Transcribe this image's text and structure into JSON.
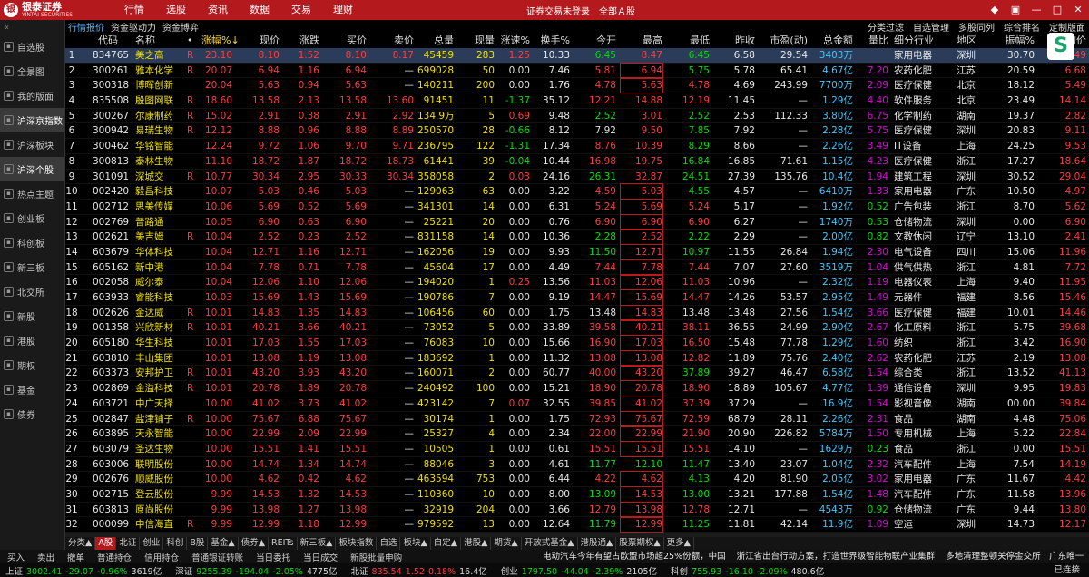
{
  "app": {
    "brand": "银泰证券",
    "brand_en": "YINTAI SECURITIES",
    "logo_mark": "银"
  },
  "top_menu": [
    "行情",
    "选股",
    "资讯",
    "数据",
    "交易",
    "理财"
  ],
  "top_status": {
    "login": "证券交易未登录",
    "scope": "全部Ａ股"
  },
  "window_controls": [
    "◆",
    "▣",
    "—",
    "□",
    "✕"
  ],
  "sidebar": [
    {
      "label": "自选股",
      "active": false
    },
    {
      "label": "全景图",
      "active": false
    },
    {
      "label": "我的版面",
      "active": false
    },
    {
      "label": "沪深京指数",
      "active": true
    },
    {
      "label": "沪深板块",
      "active": false
    },
    {
      "label": "沪深个股",
      "active": true
    },
    {
      "label": "热点主题",
      "active": false
    },
    {
      "label": "创业板",
      "active": false
    },
    {
      "label": "科创板",
      "active": false
    },
    {
      "label": "新三板",
      "active": false
    },
    {
      "label": "北交所",
      "active": false
    },
    {
      "label": "新股",
      "active": false
    },
    {
      "label": "港股",
      "active": false
    },
    {
      "label": "期权",
      "active": false
    },
    {
      "label": "基金",
      "active": false
    },
    {
      "label": "债券",
      "active": false
    }
  ],
  "sub_tabs": [
    "行情报价",
    "资金驱动力",
    "资金博弈"
  ],
  "sub_right": [
    "分类过滤",
    "自选管理",
    "多股同列",
    "综合排名",
    "定制版面"
  ],
  "columns": [
    "",
    "代码",
    "名称",
    "•",
    "涨幅%↓",
    "现价",
    "涨跌",
    "买价",
    "卖价",
    "总量",
    "现量",
    "涨速%",
    "换手%",
    "今开",
    "最高",
    "最低",
    "昨收",
    "市盈(动)",
    "总金额",
    "量比",
    "细分行业",
    "地区",
    "振幅%",
    "均价"
  ],
  "rows": [
    [
      "1",
      "834765",
      "美之高",
      "R",
      "23.10",
      "8.10",
      "1.52",
      "8.10",
      "8.17",
      "45459",
      "283",
      "1.25",
      "10.33",
      "6.45",
      "8.47",
      "6.45",
      "6.58",
      "29.54",
      "3403万",
      "",
      "家用电器",
      "深圳",
      "30.70",
      "7.49"
    ],
    [
      "2",
      "300261",
      "雅本化学",
      "R",
      "20.07",
      "6.94",
      "1.16",
      "6.94",
      "—",
      "699028",
      "50",
      "0.00",
      "7.46",
      "5.81",
      "6.94",
      "5.75",
      "5.78",
      "65.41",
      "4.67亿",
      "7.20",
      "农药化肥",
      "江苏",
      "20.59",
      "6.68"
    ],
    [
      "3",
      "300318",
      "博晖创新",
      "",
      "20.04",
      "5.63",
      "0.94",
      "5.63",
      "—",
      "140211",
      "200",
      "0.00",
      "1.76",
      "4.78",
      "5.63",
      "4.78",
      "4.69",
      "243.99",
      "7700万",
      "2.09",
      "医疗保健",
      "北京",
      "18.12",
      "5.49"
    ],
    [
      "4",
      "835508",
      "殷图网联",
      "R",
      "18.60",
      "13.58",
      "2.13",
      "13.58",
      "13.60",
      "91451",
      "11",
      "-1.37",
      "35.12",
      "12.21",
      "14.88",
      "12.19",
      "11.45",
      "—",
      "1.29亿",
      "4.40",
      "软件服务",
      "北京",
      "23.49",
      "14.14"
    ],
    [
      "5",
      "300267",
      "尔康制药",
      "R",
      "15.02",
      "2.91",
      "0.38",
      "2.91",
      "2.92",
      "134.9万",
      "5",
      "0.69",
      "9.48",
      "2.52",
      "3.01",
      "2.52",
      "2.53",
      "112.33",
      "3.80亿",
      "6.75",
      "化学制药",
      "湖南",
      "19.37",
      "2.82"
    ],
    [
      "6",
      "300942",
      "易瑞生物",
      "R",
      "12.12",
      "8.88",
      "0.96",
      "8.88",
      "8.89",
      "250570",
      "28",
      "-0.66",
      "8.12",
      "7.92",
      "9.50",
      "7.85",
      "7.92",
      "—",
      "2.28亿",
      "5.75",
      "医疗保健",
      "深圳",
      "20.83",
      "9.11"
    ],
    [
      "7",
      "300462",
      "华铭智能",
      "",
      "12.24",
      "9.72",
      "1.06",
      "9.70",
      "9.71",
      "236795",
      "122",
      "-1.31",
      "17.34",
      "8.76",
      "10.39",
      "8.29",
      "8.66",
      "—",
      "2.26亿",
      "3.49",
      "IT设备",
      "上海",
      "24.25",
      "9.53"
    ],
    [
      "8",
      "300813",
      "泰林生物",
      "",
      "11.10",
      "18.72",
      "1.87",
      "18.72",
      "18.73",
      "61441",
      "39",
      "-0.04",
      "10.44",
      "16.98",
      "19.75",
      "16.84",
      "16.85",
      "71.61",
      "1.15亿",
      "4.23",
      "医疗保健",
      "浙江",
      "17.27",
      "18.64"
    ],
    [
      "9",
      "301091",
      "深城交",
      "R",
      "10.77",
      "30.34",
      "2.95",
      "30.33",
      "30.34",
      "358058",
      "2",
      "0.03",
      "24.16",
      "26.31",
      "32.87",
      "24.51",
      "27.39",
      "135.76",
      "10.4亿",
      "1.94",
      "建筑工程",
      "深圳",
      "30.52",
      "29.04"
    ],
    [
      "10",
      "002420",
      "毅昌科技",
      "",
      "10.07",
      "5.03",
      "0.46",
      "5.03",
      "—",
      "129063",
      "63",
      "0.00",
      "3.22",
      "4.59",
      "5.03",
      "4.55",
      "4.57",
      "—",
      "6410万",
      "1.33",
      "家用电器",
      "广东",
      "10.50",
      "4.97"
    ],
    [
      "11",
      "002712",
      "思美传媒",
      "",
      "10.06",
      "5.69",
      "0.52",
      "5.69",
      "—",
      "341301",
      "14",
      "0.00",
      "6.31",
      "5.24",
      "5.69",
      "5.24",
      "5.17",
      "—",
      "1.92亿",
      "0.52",
      "广告包装",
      "浙江",
      "8.70",
      "5.62"
    ],
    [
      "12",
      "002769",
      "普路通",
      "",
      "10.05",
      "6.90",
      "0.63",
      "6.90",
      "—",
      "25221",
      "20",
      "0.00",
      "0.76",
      "6.90",
      "6.90",
      "6.90",
      "6.27",
      "—",
      "1740万",
      "0.53",
      "仓储物流",
      "深圳",
      "0.00",
      "6.90"
    ],
    [
      "13",
      "002621",
      "美吉姆",
      "R",
      "10.04",
      "2.52",
      "0.23",
      "2.52",
      "—",
      "831158",
      "14",
      "0.00",
      "10.36",
      "2.28",
      "2.52",
      "2.22",
      "2.29",
      "—",
      "2.00亿",
      "0.82",
      "文教休闲",
      "辽宁",
      "13.10",
      "2.41"
    ],
    [
      "14",
      "603679",
      "华体科技",
      "",
      "10.04",
      "12.71",
      "1.16",
      "12.71",
      "—",
      "162056",
      "19",
      "0.00",
      "9.93",
      "11.50",
      "12.71",
      "10.97",
      "11.55",
      "26.84",
      "1.94亿",
      "2.30",
      "电气设备",
      "四川",
      "15.06",
      "11.96"
    ],
    [
      "15",
      "605162",
      "新中港",
      "",
      "10.04",
      "7.78",
      "0.71",
      "7.78",
      "—",
      "45604",
      "17",
      "0.00",
      "4.49",
      "7.44",
      "7.78",
      "7.44",
      "7.07",
      "27.60",
      "3519万",
      "1.04",
      "供气供热",
      "浙江",
      "4.81",
      "7.72"
    ],
    [
      "16",
      "002058",
      "威尔泰",
      "",
      "10.04",
      "12.06",
      "1.10",
      "12.06",
      "—",
      "194020",
      "1",
      "0.25",
      "13.56",
      "11.03",
      "12.06",
      "11.03",
      "10.96",
      "—",
      "2.32亿",
      "1.19",
      "电器仪表",
      "上海",
      "9.40",
      "11.95"
    ],
    [
      "17",
      "603933",
      "睿能科技",
      "",
      "10.03",
      "15.69",
      "1.43",
      "15.69",
      "—",
      "190786",
      "7",
      "0.00",
      "9.19",
      "14.47",
      "15.69",
      "14.47",
      "14.26",
      "53.57",
      "2.95亿",
      "1.49",
      "元器件",
      "福建",
      "8.56",
      "15.46"
    ],
    [
      "18",
      "002626",
      "金达威",
      "R",
      "10.01",
      "14.83",
      "1.35",
      "14.83",
      "—",
      "106456",
      "60",
      "0.00",
      "1.75",
      "13.48",
      "14.83",
      "13.48",
      "13.48",
      "27.56",
      "1.54亿",
      "3.66",
      "医疗保健",
      "福建",
      "10.01",
      "14.46"
    ],
    [
      "19",
      "001358",
      "兴欣新材",
      "R",
      "10.01",
      "40.21",
      "3.66",
      "40.21",
      "—",
      "73052",
      "5",
      "0.00",
      "33.89",
      "39.58",
      "40.21",
      "38.11",
      "36.55",
      "24.99",
      "2.90亿",
      "2.67",
      "化工原料",
      "浙江",
      "5.75",
      "39.68"
    ],
    [
      "20",
      "605180",
      "华生科技",
      "",
      "10.01",
      "17.03",
      "1.55",
      "17.03",
      "—",
      "76083",
      "10",
      "0.00",
      "15.66",
      "16.90",
      "17.03",
      "16.50",
      "15.48",
      "77.78",
      "1.29亿",
      "1.60",
      "纺织",
      "浙江",
      "3.42",
      "16.90"
    ],
    [
      "21",
      "603810",
      "丰山集团",
      "",
      "10.01",
      "13.08",
      "1.19",
      "13.08",
      "—",
      "183692",
      "1",
      "0.00",
      "11.32",
      "13.08",
      "13.08",
      "12.82",
      "11.89",
      "75.76",
      "2.40亿",
      "2.62",
      "农药化肥",
      "江苏",
      "2.19",
      "13.08"
    ],
    [
      "22",
      "603373",
      "安邦护卫",
      "R",
      "10.01",
      "43.20",
      "3.93",
      "43.20",
      "—",
      "160071",
      "2",
      "0.00",
      "60.77",
      "40.00",
      "43.20",
      "37.89",
      "39.27",
      "46.47",
      "6.58亿",
      "1.54",
      "综合类",
      "浙江",
      "13.52",
      "41.13"
    ],
    [
      "23",
      "002869",
      "金溢科技",
      "R",
      "10.01",
      "20.78",
      "1.89",
      "20.78",
      "—",
      "240492",
      "100",
      "0.00",
      "15.21",
      "18.90",
      "20.78",
      "18.90",
      "18.89",
      "105.67",
      "4.77亿",
      "1.39",
      "通信设备",
      "深圳",
      "9.95",
      "19.83"
    ],
    [
      "24",
      "603721",
      "中广天择",
      "",
      "10.00",
      "41.02",
      "3.73",
      "41.02",
      "—",
      "423142",
      "7",
      "0.07",
      "32.55",
      "39.85",
      "41.02",
      "37.39",
      "37.29",
      "—",
      "16.9亿",
      "1.54",
      "影视音像",
      "湖南",
      "00.00",
      "39.84"
    ],
    [
      "25",
      "002847",
      "盐津铺子",
      "R",
      "10.00",
      "75.67",
      "6.88",
      "75.67",
      "—",
      "30174",
      "1",
      "0.00",
      "1.75",
      "72.93",
      "75.67",
      "72.59",
      "68.79",
      "28.11",
      "2.26亿",
      "2.31",
      "食品",
      "湖南",
      "4.48",
      "75.06"
    ],
    [
      "26",
      "603895",
      "天永智能",
      "",
      "10.00",
      "22.99",
      "2.09",
      "22.99",
      "—",
      "25327",
      "4",
      "0.00",
      "2.34",
      "22.00",
      "22.99",
      "21.90",
      "20.90",
      "226.82",
      "5784万",
      "1.50",
      "专用机械",
      "上海",
      "5.22",
      "22.84"
    ],
    [
      "27",
      "603079",
      "圣达生物",
      "",
      "10.00",
      "15.51",
      "1.41",
      "15.51",
      "—",
      "10505",
      "1",
      "0.00",
      "0.61",
      "15.51",
      "15.51",
      "15.51",
      "14.10",
      "—",
      "1629万",
      "0.23",
      "食品",
      "浙江",
      "0.00",
      "15.51"
    ],
    [
      "28",
      "603006",
      "联明股份",
      "",
      "10.00",
      "14.74",
      "1.34",
      "14.74",
      "—",
      "88046",
      "3",
      "0.00",
      "4.61",
      "11.77",
      "12.10",
      "11.47",
      "13.40",
      "23.07",
      "1.04亿",
      "2.32",
      "汽车配件",
      "上海",
      "7.54",
      "14.19"
    ],
    [
      "29",
      "002676",
      "顺威股份",
      "",
      "10.00",
      "4.62",
      "0.42",
      "4.62",
      "—",
      "463594",
      "753",
      "0.00",
      "6.44",
      "4.22",
      "4.62",
      "4.13",
      "4.20",
      "81.90",
      "2.05亿",
      "3.02",
      "家用电器",
      "广东",
      "11.67",
      "4.42"
    ],
    [
      "30",
      "002715",
      "登云股份",
      "",
      "9.99",
      "14.53",
      "1.32",
      "14.53",
      "—",
      "110360",
      "10",
      "0.00",
      "8.00",
      "13.09",
      "14.53",
      "13.00",
      "13.21",
      "177.88",
      "1.54亿",
      "1.48",
      "汽车配件",
      "广东",
      "11.58",
      "13.96"
    ],
    [
      "31",
      "603813",
      "原尚股份",
      "",
      "9.99",
      "13.98",
      "1.27",
      "13.98",
      "—",
      "32919",
      "204",
      "0.00",
      "3.66",
      "12.79",
      "13.98",
      "12.78",
      "12.71",
      "—",
      "4543万",
      "0.92",
      "仓储物流",
      "广东",
      "9.44",
      "13.80"
    ],
    [
      "32",
      "000099",
      "中信海直",
      "R",
      "9.99",
      "12.99",
      "1.18",
      "12.99",
      "—",
      "979592",
      "13",
      "0.00",
      "12.64",
      "11.79",
      "12.99",
      "11.25",
      "11.81",
      "42.14",
      "11.9亿",
      "1.09",
      "空运",
      "深圳",
      "14.73",
      "12.17"
    ]
  ],
  "bottom_tabs": [
    "分类▲",
    "A股",
    "北证",
    "创业",
    "科创",
    "B股",
    "基金▲",
    "债券▲",
    "REITs",
    "新三板▲",
    "板块指数",
    "自选",
    "板块▲",
    "自定▲",
    "港股▲",
    "期货▲",
    "开放式基金▲",
    "港股通▲",
    "股票期权▲",
    "更多▲"
  ],
  "bottom_actions": [
    "买入",
    "卖出",
    "撤单",
    "普通持仓",
    "信用持仓",
    "普通银证转账",
    "当日委托",
    "当日成交",
    "新股批量申购"
  ],
  "ticker_news": [
    "电动汽车今年有望占欧盟市场超25%份额，中国",
    "浙江省出台行动方案，打造世界级智能物联产业集群",
    "多地清理整顿关停金交所　广东唯一"
  ],
  "index_bar": [
    {
      "name": "上证",
      "val": "3002.41",
      "chg": "-29.07",
      "pct": "-0.96%",
      "amt": "3619亿"
    },
    {
      "name": "深证",
      "val": "9255.39",
      "chg": "-194.04",
      "pct": "-2.05%",
      "amt": "4775亿"
    },
    {
      "name": "北证",
      "val": "835.54",
      "chg": "1.52",
      "pct": "0.18%",
      "amt": "16.4亿"
    },
    {
      "name": "创业",
      "val": "1797.50",
      "chg": "-44.04",
      "pct": "-2.39%",
      "amt": "2105亿"
    },
    {
      "name": "科创",
      "val": "755.93",
      "chg": "-16.10",
      "pct": "-2.09%",
      "amt": "480.6亿"
    }
  ],
  "status_right": "已连接"
}
